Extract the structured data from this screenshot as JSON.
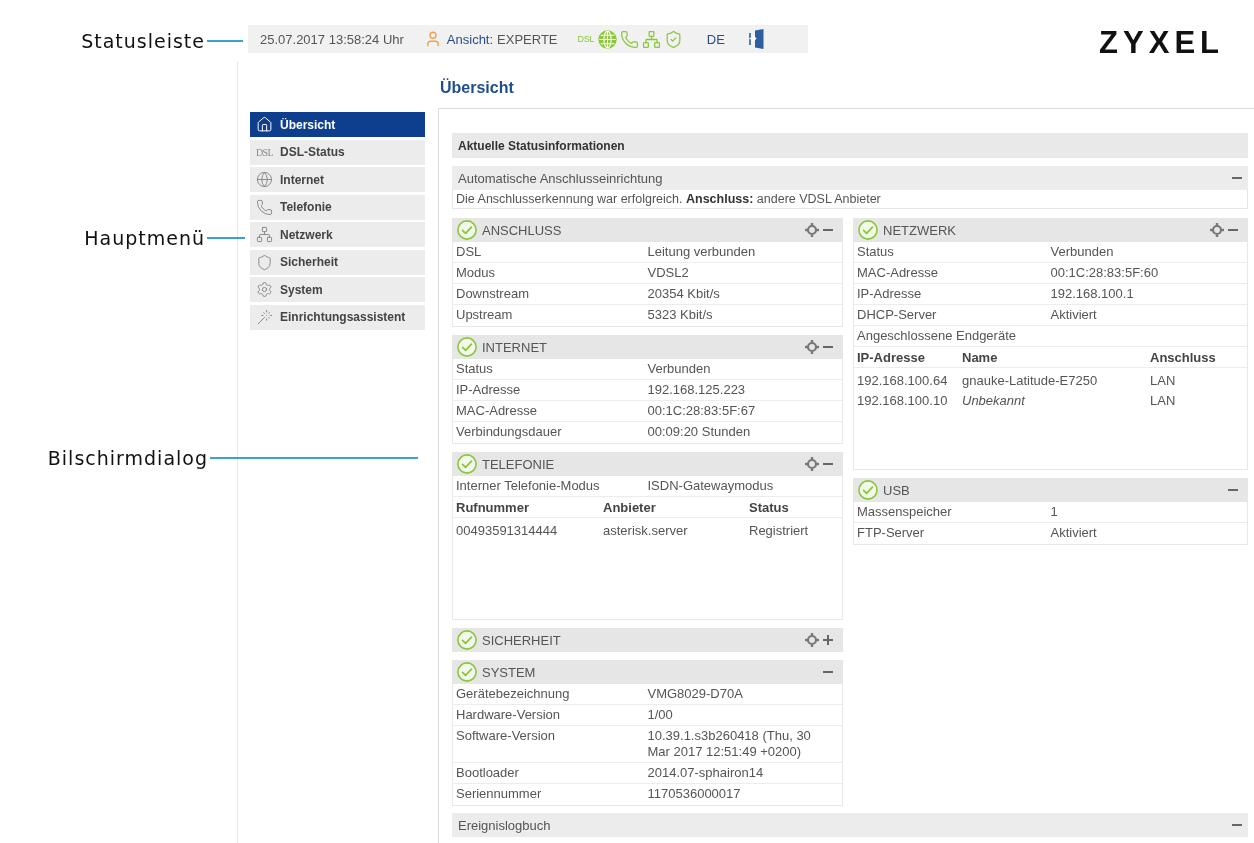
{
  "annotations": [
    {
      "label": "Statusleiste"
    },
    {
      "label": "Hauptmenü"
    },
    {
      "label": "Bilschirmdialog"
    }
  ],
  "status_bar": {
    "datetime": "25.07.2017 13:58:24 Uhr",
    "view_label": "Ansicht:",
    "view_value": "EXPERTE",
    "indicators": [
      {
        "kind": "dsl",
        "text": "DSL",
        "active": true
      },
      {
        "kind": "internet",
        "active": true
      },
      {
        "kind": "phone",
        "active": true
      },
      {
        "kind": "network",
        "active": true
      },
      {
        "kind": "security",
        "active": true
      }
    ],
    "language": "DE"
  },
  "logo": "ZYXEL",
  "page_title": "Übersicht",
  "sidebar": {
    "items": [
      {
        "label": "Übersicht",
        "kind": "home",
        "selected": true
      },
      {
        "label": "DSL-Status",
        "kind": "dsl",
        "icon_text": "DSL",
        "selected": false
      },
      {
        "label": "Internet",
        "kind": "internet",
        "selected": false
      },
      {
        "label": "Telefonie",
        "kind": "phone",
        "selected": false
      },
      {
        "label": "Netzwerk",
        "kind": "network",
        "selected": false
      },
      {
        "label": "Sicherheit",
        "kind": "security",
        "selected": false
      },
      {
        "label": "System",
        "kind": "system",
        "selected": false
      },
      {
        "label": "Einrichtungsassistent",
        "kind": "wizard",
        "selected": false
      }
    ]
  },
  "panel": {
    "title": "Aktuelle Statusinformationen",
    "setup": {
      "title": "Automatische Anschlusseinrichtung",
      "expanded": true,
      "message": "Die Anschlusserkennung war erfolgreich. **Anschluss:** andere VDSL Anbieter"
    },
    "columns": [
      {
        "sections": [
          {
            "title": "ANSCHLUSS",
            "ok": true,
            "configurable": true,
            "expanded": true,
            "rows": [
              {
                "kind": "pair",
                "label": "DSL",
                "value": "Leitung verbunden"
              },
              {
                "kind": "pair",
                "label": "Modus",
                "value": "VDSL2"
              },
              {
                "kind": "pair",
                "label": "Downstream",
                "value": "20354 Kbit/s"
              },
              {
                "kind": "pair",
                "label": "Upstream",
                "value": "5323 Kbit/s"
              }
            ]
          },
          {
            "title": "INTERNET",
            "ok": true,
            "configurable": true,
            "expanded": true,
            "rows": [
              {
                "kind": "pair",
                "label": "Status",
                "value": "Verbunden"
              },
              {
                "kind": "pair",
                "label": "IP-Adresse",
                "value": "192.168.125.223"
              },
              {
                "kind": "pair",
                "label": "MAC-Adresse",
                "value": "00:1C:28:83:5F:67"
              },
              {
                "kind": "pair",
                "label": "Verbindungsdauer",
                "value": "00:09:20 Stunden"
              }
            ]
          },
          {
            "title": "TELEFONIE",
            "ok": true,
            "configurable": true,
            "expanded": true,
            "rows": [
              {
                "kind": "pair",
                "label": "Interner Telefonie-Modus",
                "value": "ISDN-Gatewaymodus"
              },
              {
                "kind": "phone_table",
                "columns": [
                  "Rufnummer",
                  "Anbieter",
                  "Status"
                ],
                "entries": [
                  {
                    "cells": [
                      "00493591314444",
                      "asterisk.server",
                      "Registriert"
                    ],
                    "unknown": false
                  }
                ]
              }
            ]
          },
          {
            "title": "SICHERHEIT",
            "ok": true,
            "configurable": true,
            "expanded": false
          },
          {
            "title": "SYSTEM",
            "ok": true,
            "configurable": false,
            "expanded": true,
            "rows": [
              {
                "kind": "pair",
                "label": "Gerätebezeichnung",
                "value": "VMG8029-D70A"
              },
              {
                "kind": "pair",
                "label": "Hardware-Version",
                "value": "1/00"
              },
              {
                "kind": "pair",
                "label": "Software-Version",
                "value": "10.39.1.s3b260418 (Thu, 30 Mar 2017 12:51:49 +0200)"
              },
              {
                "kind": "pair",
                "label": "Bootloader",
                "value": "2014.07-sphairon14"
              },
              {
                "kind": "pair",
                "label": "Seriennummer",
                "value": "1170536000017"
              }
            ]
          }
        ]
      },
      {
        "sections": [
          {
            "title": "NETZWERK",
            "ok": true,
            "configurable": true,
            "expanded": true,
            "rows": [
              {
                "kind": "pair",
                "label": "Status",
                "value": "Verbunden"
              },
              {
                "kind": "pair",
                "label": "MAC-Adresse",
                "value": "00:1C:28:83:5F:60"
              },
              {
                "kind": "pair",
                "label": "IP-Adresse",
                "value": "192.168.100.1"
              },
              {
                "kind": "pair",
                "label": "DHCP-Server",
                "value": "Aktiviert"
              },
              {
                "kind": "note",
                "text": "Angeschlossene Endgeräte"
              },
              {
                "kind": "device_table",
                "columns": [
                  "IP-Adresse",
                  "Name",
                  "Anschluss"
                ],
                "entries": [
                  {
                    "cells": [
                      "192.168.100.64",
                      "gnauke-Latitude-E7250",
                      "LAN"
                    ],
                    "unknown": false
                  },
                  {
                    "cells": [
                      "192.168.100.10",
                      "Unbekannt",
                      "LAN"
                    ],
                    "unknown": true
                  }
                ]
              }
            ]
          },
          {
            "title": "USB",
            "ok": true,
            "configurable": false,
            "expanded": true,
            "rows": [
              {
                "kind": "pair",
                "label": "Massenspeicher",
                "value": "1"
              },
              {
                "kind": "pair",
                "label": "FTP-Server",
                "value": "Aktiviert"
              }
            ]
          }
        ]
      }
    ],
    "event_log": {
      "title": "Ereignislogbuch",
      "expanded": true
    }
  }
}
